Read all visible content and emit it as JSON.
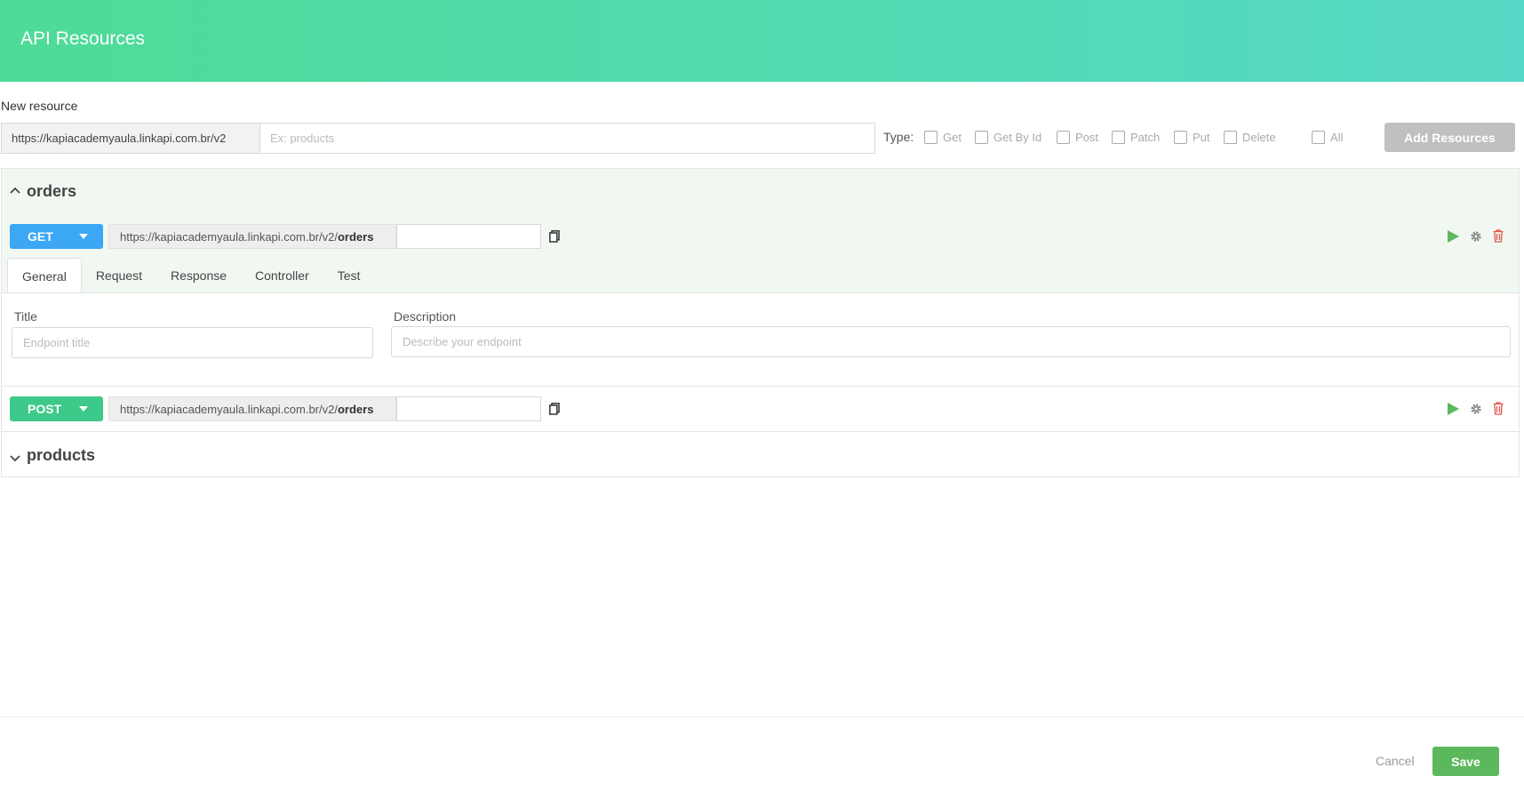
{
  "header": {
    "title": "API Resources"
  },
  "new_resource": {
    "label": "New resource",
    "base_url": "https://kapiacademyaula.linkapi.com.br/v2",
    "placeholder": "Ex: products",
    "type_label": "Type:",
    "types": [
      "Get",
      "Get By Id",
      "Post",
      "Patch",
      "Put",
      "Delete"
    ],
    "all_label": "All",
    "add_button": "Add Resources"
  },
  "groups": [
    {
      "name": "orders",
      "expanded": true,
      "endpoints": [
        {
          "method": "GET",
          "color": "#3ba7f5",
          "base": "https://kapiacademyaula.linkapi.com.br/v2/",
          "path": "orders"
        },
        {
          "method": "POST",
          "color": "#3dc98a",
          "base": "https://kapiacademyaula.linkapi.com.br/v2/",
          "path": "orders"
        }
      ],
      "tabs": [
        "General",
        "Request",
        "Response",
        "Controller",
        "Test"
      ],
      "active_tab": "General",
      "general": {
        "title_label": "Title",
        "title_placeholder": "Endpoint title",
        "description_label": "Description",
        "description_placeholder": "Describe your endpoint"
      }
    },
    {
      "name": "products",
      "expanded": false
    }
  ],
  "footer": {
    "cancel": "Cancel",
    "save": "Save"
  },
  "colors": {
    "header_start": "#4edb97",
    "header_end": "#56d8c6",
    "run": "#5cb85c",
    "delete": "#e0564a"
  }
}
